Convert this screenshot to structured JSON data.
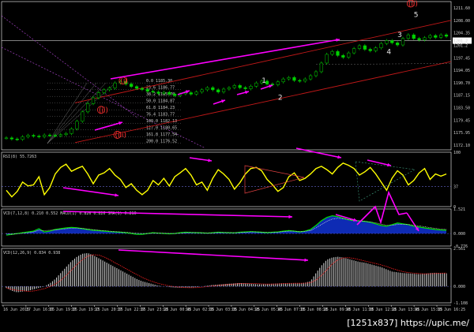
{
  "chart_data": {
    "type": "line",
    "symbol_info": "",
    "price_panel": {
      "ylim": [
        1171.0,
        1212.0
      ],
      "y_ticks": [
        "1211.60",
        "1208.00",
        "1204.35",
        "1201.2",
        "1197.45",
        "1194.05",
        "1190.70",
        "1187.15",
        "1183.50",
        "1179.45",
        "1175.95",
        "1172.10"
      ],
      "fib_levels": [
        "1185.30",
        "1186.77",
        "1185.70",
        "1184.87",
        "1184.23",
        "1183.77",
        "1182.13",
        "1180.65",
        "1177.54",
        "1176.52"
      ],
      "fib_pct": [
        "0.0",
        "23.6",
        "38.2",
        "50.0",
        "61.8",
        "76.4",
        "100.0",
        "127.0",
        "161.8",
        "200.0"
      ],
      "last_price": "1201.2",
      "close_series": [
        1174.3,
        1174.0,
        1173.9,
        1174.6,
        1175.0,
        1174.8,
        1174.6,
        1175.1,
        1175.0,
        1174.9,
        1175.2,
        1175.5,
        1176.8,
        1178.9,
        1181.5,
        1183.8,
        1185.4,
        1186.8,
        1187.6,
        1188.1,
        1189.5,
        1189.9,
        1189.2,
        1188.5,
        1188.0,
        1187.7,
        1187.2,
        1187.0,
        1186.6,
        1186.9,
        1186.4,
        1186.0,
        1186.5,
        1186.8,
        1186.4,
        1187.0,
        1187.6,
        1188.2,
        1187.6,
        1187.0,
        1187.8,
        1188.2,
        1188.8,
        1188.2,
        1187.9,
        1188.6,
        1189.5,
        1190.0,
        1189.2,
        1189.0,
        1189.8,
        1190.6,
        1191.0,
        1190.2,
        1190.0,
        1190.6,
        1191.5,
        1192.6,
        1195.0,
        1197.4,
        1198.2,
        1197.1,
        1196.6,
        1197.8,
        1199.0,
        1199.8,
        1198.8,
        1198.4,
        1199.2,
        1200.4,
        1201.2,
        1200.6,
        1200.0,
        1201.8,
        1202.8,
        1201.8,
        1201.4,
        1202.0,
        1202.6,
        1202.1,
        1202.8,
        1202.4
      ]
    },
    "wave_labels": [
      {
        "text": "(i)",
        "color": "#ff3030",
        "x": 21,
        "price": 1189.5
      },
      {
        "text": "(ii)",
        "color": "#ff3030",
        "x": 17,
        "price": 1181.4
      },
      {
        "text": "(iii)",
        "color": "#ff3030",
        "x": 20,
        "price": 1174.5
      },
      {
        "text": "(ii)",
        "color": "#ff3030",
        "x": 74,
        "price": 1210.8
      },
      {
        "text": "1",
        "color": "#e6e6e6",
        "x": 47,
        "price": 1189.5
      },
      {
        "text": "2",
        "color": "#e6e6e6",
        "x": 50,
        "price": 1184.8
      },
      {
        "text": "3",
        "color": "#e6e6e6",
        "x": 72,
        "price": 1202.2
      },
      {
        "text": "4",
        "color": "#e6e6e6",
        "x": 70,
        "price": 1197.5
      },
      {
        "text": "5",
        "color": "#e6e6e6",
        "x": 75,
        "price": 1207.8
      }
    ],
    "rsi_panel": {
      "title": "RSI(8) 55.7263",
      "ylim": [
        0,
        100
      ],
      "y_ticks": [
        "100",
        "37",
        "0"
      ],
      "values": [
        30,
        18,
        28,
        45,
        38,
        40,
        55,
        22,
        35,
        60,
        72,
        78,
        65,
        70,
        74,
        60,
        42,
        58,
        62,
        70,
        58,
        50,
        35,
        42,
        30,
        22,
        30,
        48,
        40,
        52,
        38,
        55,
        62,
        70,
        58,
        40,
        45,
        30,
        52,
        68,
        60,
        50,
        32,
        44,
        60,
        70,
        72,
        66,
        50,
        40,
        28,
        35,
        55,
        62,
        48,
        52,
        60,
        70,
        74,
        68,
        60,
        72,
        80,
        76,
        70,
        58,
        64,
        72,
        60,
        45,
        30,
        52,
        66,
        58,
        40,
        48,
        62,
        70,
        50,
        60,
        56,
        60
      ]
    },
    "macd_panel": {
      "title": "VCD(7,12,8) 0.210 0.552 MACD(1) 0.826 0.826 SMA(1) 0.210",
      "ylim": [
        -0.776,
        1.521
      ],
      "y_ticks": [
        "1.521",
        "0.000",
        "-0.776"
      ],
      "macd": [
        -0.1,
        -0.05,
        0.0,
        0.05,
        0.1,
        0.15,
        0.3,
        0.1,
        0.15,
        0.25,
        0.3,
        0.35,
        0.38,
        0.36,
        0.3,
        0.25,
        0.2,
        0.18,
        0.15,
        0.12,
        0.1,
        0.08,
        0.05,
        0.0,
        -0.05,
        -0.05,
        0.0,
        0.05,
        0.02,
        0.0,
        -0.02,
        0.0,
        0.05,
        0.08,
        0.06,
        0.05,
        0.04,
        0.02,
        0.05,
        0.08,
        0.06,
        0.05,
        0.04,
        0.08,
        0.1,
        0.12,
        0.1,
        0.08,
        0.05,
        0.08,
        0.1,
        0.15,
        0.18,
        0.15,
        0.1,
        0.15,
        0.25,
        0.5,
        0.8,
        1.0,
        1.1,
        1.05,
        0.95,
        0.85,
        0.8,
        0.78,
        0.75,
        0.7,
        0.6,
        0.5,
        0.45,
        0.55,
        0.65,
        0.6,
        0.55,
        0.45,
        0.4,
        0.35,
        0.3,
        0.25,
        0.22,
        0.2
      ],
      "signal": [
        0.0,
        -0.05,
        -0.02,
        0.02,
        0.05,
        0.1,
        0.2,
        0.18,
        0.2,
        0.22,
        0.26,
        0.3,
        0.33,
        0.34,
        0.32,
        0.28,
        0.24,
        0.2,
        0.18,
        0.15,
        0.12,
        0.1,
        0.08,
        0.05,
        0.02,
        0.0,
        0.0,
        0.02,
        0.03,
        0.02,
        0.01,
        0.0,
        0.02,
        0.05,
        0.06,
        0.06,
        0.05,
        0.04,
        0.04,
        0.06,
        0.06,
        0.06,
        0.05,
        0.06,
        0.08,
        0.1,
        0.1,
        0.09,
        0.08,
        0.08,
        0.09,
        0.12,
        0.15,
        0.15,
        0.13,
        0.14,
        0.18,
        0.35,
        0.55,
        0.75,
        0.9,
        0.95,
        0.92,
        0.86,
        0.82,
        0.79,
        0.76,
        0.72,
        0.66,
        0.58,
        0.52,
        0.52,
        0.56,
        0.58,
        0.56,
        0.52,
        0.47,
        0.42,
        0.37,
        0.32,
        0.28,
        0.25
      ]
    },
    "osc_panel": {
      "title": "VCD(12,26,9) 0.834 0.938",
      "ylim": [
        -1.108,
        2.561
      ],
      "y_ticks": [
        "2.561",
        "0.000",
        "-1.108"
      ],
      "values": [
        -0.1,
        -0.3,
        -0.4,
        -0.35,
        -0.3,
        -0.2,
        -0.1,
        0.0,
        0.2,
        0.5,
        0.9,
        1.3,
        1.7,
        2.0,
        2.2,
        2.25,
        2.1,
        1.9,
        1.7,
        1.5,
        1.3,
        1.1,
        0.9,
        0.7,
        0.5,
        0.35,
        0.25,
        0.15,
        0.05,
        0.0,
        -0.05,
        -0.08,
        -0.1,
        -0.1,
        -0.08,
        -0.05,
        0.0,
        0.05,
        0.1,
        0.12,
        0.15,
        0.18,
        0.2,
        0.22,
        0.2,
        0.18,
        0.15,
        0.14,
        0.15,
        0.18,
        0.2,
        0.22,
        0.22,
        0.2,
        0.2,
        0.25,
        0.35,
        0.9,
        1.4,
        1.8,
        1.95,
        2.0,
        1.95,
        1.85,
        1.75,
        1.65,
        1.6,
        1.5,
        1.4,
        1.3,
        1.15,
        1.0,
        0.95,
        0.9,
        0.88,
        0.85,
        0.82,
        0.85,
        0.9,
        0.92,
        0.9,
        0.88
      ]
    },
    "time_axis": [
      "16 Jun 2015",
      "17 Jun 16:05",
      "17 Jun 19:05",
      "17 Jun 19:25",
      "17 Jun 20:05",
      "17 Jun 22:05",
      "17 Jun 23:25",
      "18 Jun 00:45",
      "18 Jun 02:05",
      "18 Jun 03:05",
      "18 Jun 04:25",
      "18 Jun 05:45",
      "18 Jun 07:05",
      "18 Jun 08:25",
      "18 Jun 09:45",
      "18 Jun 11:05",
      "18 Jun 12:25",
      "18 Jun 13:45",
      "18 Jun 15:05",
      "18 Jun 16:25"
    ],
    "colors": {
      "background": "#000000",
      "candles": "#00d000",
      "rsi": "#ffff00",
      "macd_line": "#00e000",
      "macd_hist": "#1030c8",
      "macd_signal": "#ffffff",
      "osc_bars": "#c8c8c8",
      "osc_signal": "#ff2020",
      "trend_arrows": "#ff00ff",
      "channel": "#c01818",
      "panel_border": "#ffffff"
    }
  },
  "watermark": "[1251x837] https://upic.me/"
}
